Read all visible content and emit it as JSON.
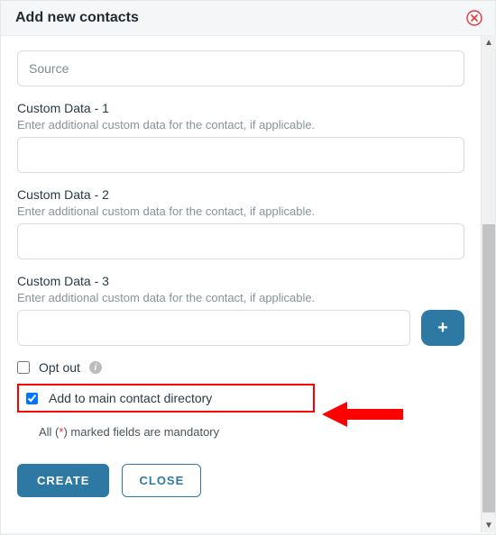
{
  "header": {
    "title": "Add new contacts"
  },
  "source": {
    "placeholder": "Source",
    "value": ""
  },
  "custom1": {
    "label": "Custom Data - 1",
    "help": "Enter additional custom data for the contact, if applicable.",
    "value": ""
  },
  "custom2": {
    "label": "Custom Data - 2",
    "help": "Enter additional custom data for the contact, if applicable.",
    "value": ""
  },
  "custom3": {
    "label": "Custom Data - 3",
    "help": "Enter additional custom data for the contact, if applicable.",
    "value": ""
  },
  "optout": {
    "label": "Opt out",
    "checked": false
  },
  "adddir": {
    "label": "Add to main contact directory",
    "checked": true
  },
  "mandatory": {
    "prefix": "All (",
    "star": "*",
    "suffix": ") marked fields are mandatory"
  },
  "footer": {
    "create": "CREATE",
    "close": "CLOSE"
  },
  "icons": {
    "plus": "+",
    "info": "i"
  },
  "colors": {
    "primary": "#2e79a3",
    "highlight": "#ff0000"
  }
}
